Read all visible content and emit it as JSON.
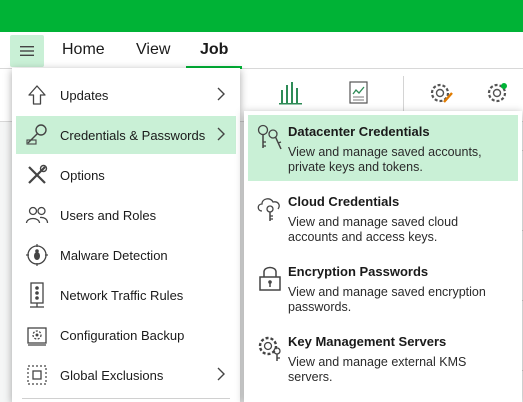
{
  "ribbon": {
    "tabs": [
      {
        "label": "Home"
      },
      {
        "label": "View"
      },
      {
        "label": "Job"
      }
    ]
  },
  "main_menu": {
    "items": [
      {
        "label": "Updates",
        "icon": "upload-arrow-icon",
        "has_submenu": true
      },
      {
        "label": "Credentials & Passwords",
        "icon": "key-icon",
        "has_submenu": true,
        "active": true
      },
      {
        "label": "Options",
        "icon": "tools-icon",
        "has_submenu": false
      },
      {
        "label": "Users and Roles",
        "icon": "users-icon",
        "has_submenu": false
      },
      {
        "label": "Malware Detection",
        "icon": "bug-target-icon",
        "has_submenu": false
      },
      {
        "label": "Network Traffic Rules",
        "icon": "network-traffic-icon",
        "has_submenu": false
      },
      {
        "label": "Configuration Backup",
        "icon": "configuration-backup-icon",
        "has_submenu": false
      },
      {
        "label": "Global Exclusions",
        "icon": "global-exclusions-icon",
        "has_submenu": true
      }
    ]
  },
  "submenu": {
    "items": [
      {
        "title": "Datacenter Credentials",
        "desc": "View and manage saved accounts, private keys and tokens.",
        "icon": "datacenter-keys-icon",
        "active": true
      },
      {
        "title": "Cloud Credentials",
        "desc": "View and manage saved cloud accounts and access keys.",
        "icon": "cloud-key-icon"
      },
      {
        "title": "Encryption Passwords",
        "desc": "View and manage saved encryption passwords.",
        "icon": "padlock-icon"
      },
      {
        "title": "Key Management Servers",
        "desc": "View and manage external KMS servers.",
        "icon": "kms-gear-key-icon"
      }
    ]
  },
  "colors": {
    "brand_green": "#00b336",
    "highlight": "#c9f0d6"
  }
}
